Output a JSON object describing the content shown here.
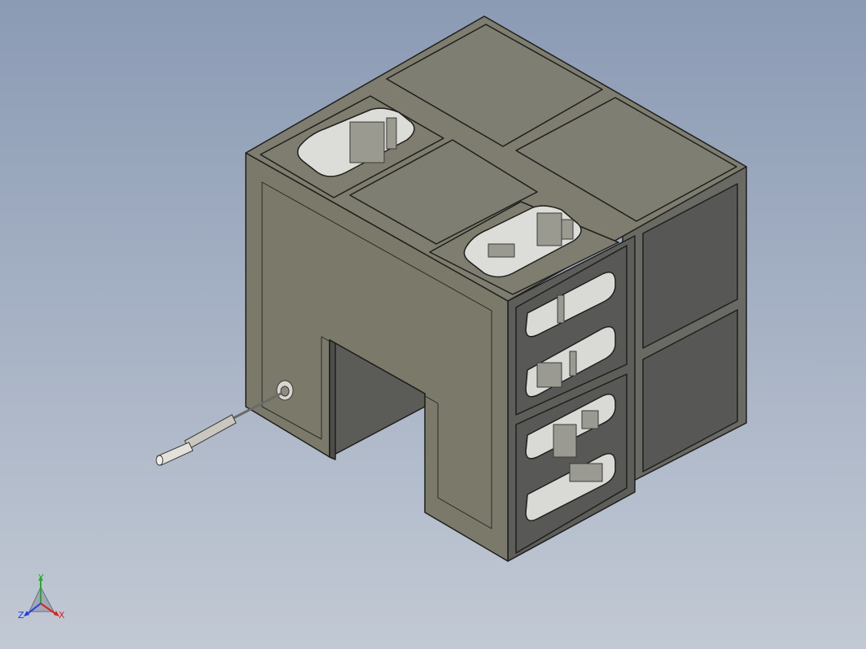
{
  "viewport": {
    "background_top": "#8b9bb4",
    "background_bottom": "#c2c9d4",
    "model_body_color": "#7c7b6a",
    "model_shade_color": "#6c6b5c",
    "panel_dark_color": "#5e5e5c",
    "outline_color": "#1f1f1c"
  },
  "triad": {
    "x_label": "X",
    "y_label": "Y",
    "z_label": "Z",
    "x_color": "#e02020",
    "y_color": "#20b020",
    "z_color": "#2040e0"
  }
}
